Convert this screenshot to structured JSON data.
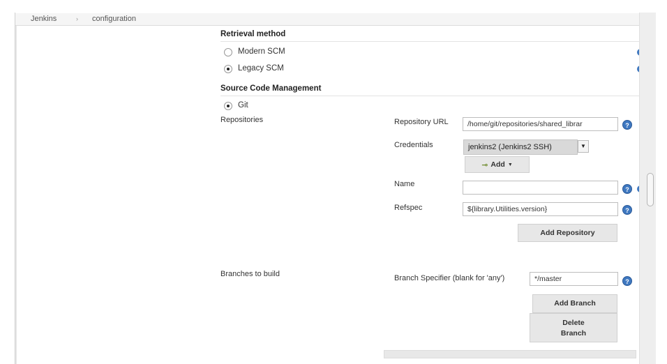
{
  "breadcrumb": {
    "root": "Jenkins",
    "separator": "›",
    "current": "configuration"
  },
  "retrieval": {
    "header": "Retrieval method",
    "options": [
      {
        "label": "Modern SCM",
        "checked": false
      },
      {
        "label": "Legacy SCM",
        "checked": true
      }
    ]
  },
  "scm": {
    "header": "Source Code Management",
    "git_label": "Git",
    "git_checked": true,
    "repositories_label": "Repositories",
    "repo_url_label": "Repository URL",
    "repo_url_value": "/home/git/repositories/shared_librar",
    "credentials_label": "Credentials",
    "credentials_value": "jenkins2 (Jenkins2 SSH)",
    "add_label": "Add",
    "name_label": "Name",
    "name_value": "",
    "refspec_label": "Refspec",
    "refspec_value": "${library.Utilities.version}",
    "add_repository_label": "Add Repository"
  },
  "branches": {
    "label": "Branches to build",
    "specifier_label": "Branch Specifier (blank for 'any')",
    "specifier_value": "*/master",
    "add_branch_label": "Add Branch",
    "delete_branch_line1": "Delete",
    "delete_branch_line2": "Branch"
  },
  "help_icon_text": "?",
  "colors": {
    "help": "#3f78c0",
    "button": "#e7e7e7",
    "select": "#d9d9d9"
  }
}
